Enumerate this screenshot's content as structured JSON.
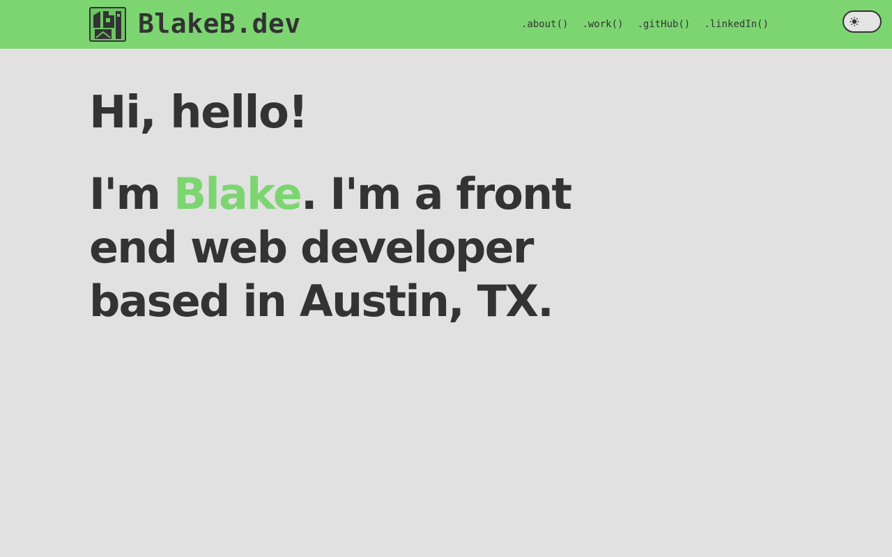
{
  "header": {
    "brand": "BlakeB.dev",
    "logo_icon": "house-tree-logo-icon",
    "nav": [
      {
        "label": ".about()"
      },
      {
        "label": ".work()"
      },
      {
        "label": ".gitHub()"
      },
      {
        "label": ".linkedIn()"
      }
    ],
    "theme_toggle_icon": "sun-icon"
  },
  "hero": {
    "greeting": "Hi, hello!",
    "intro_prefix": "I'm ",
    "name": "Blake",
    "intro_suffix": ". I'm a front end web developer based in Austin, TX."
  },
  "colors": {
    "accent": "#7dd572",
    "text": "#333333",
    "background": "#e1e1e1"
  }
}
